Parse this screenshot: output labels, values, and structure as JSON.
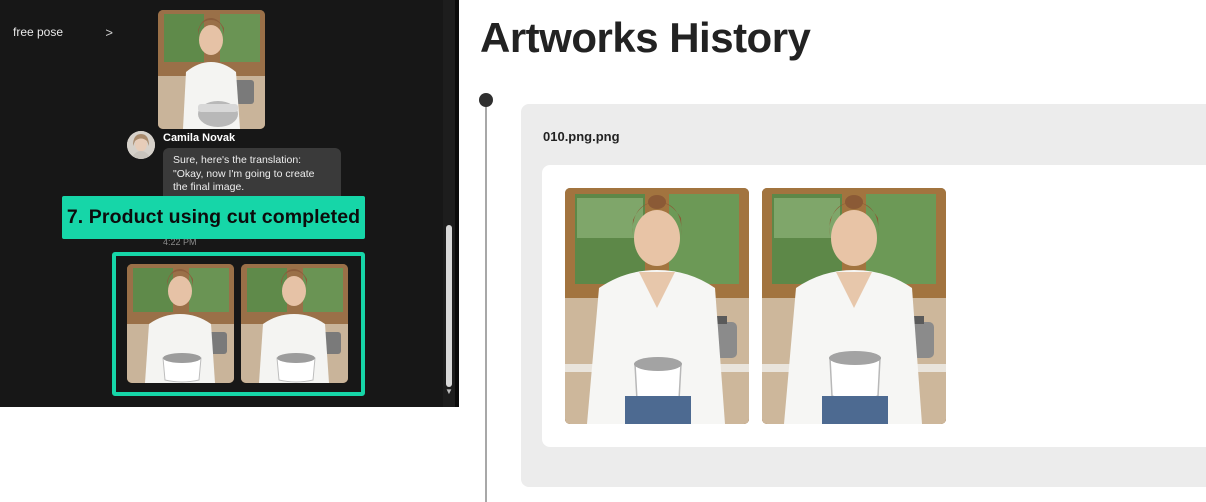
{
  "chat": {
    "sidebar_item_label": "free pose",
    "sidebar_item_chevron": ">",
    "sender_name": "Camila Novak",
    "message_lines": [
      "Sure, here's the translation:",
      "\"Okay, now I'm going to create",
      "the final image."
    ],
    "timestamp": "4:22 PM",
    "step_banner": "7. Product using cut completed",
    "highlight_color": "#16d6a8"
  },
  "artworks": {
    "title": "Artworks History",
    "entries": [
      {
        "file_name": "010.png.png",
        "image_count": 2
      }
    ]
  },
  "icons": {
    "chevron": "chevron-right-icon",
    "scroll_down": "scroll-down-arrow-icon"
  }
}
